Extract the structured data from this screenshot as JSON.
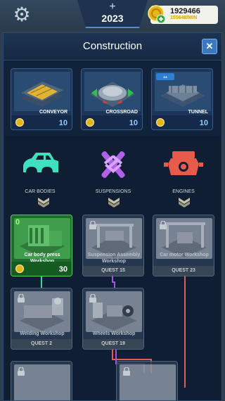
{
  "header": {
    "year_plus": "+",
    "year": "2023",
    "coins": "1929466",
    "rate": "155648/MIN"
  },
  "panel": {
    "title": "Construction",
    "close_label": "✕"
  },
  "top_cards": [
    {
      "name": "CONVEYOR",
      "price": "10"
    },
    {
      "name": "CROSSROAD",
      "price": "10"
    },
    {
      "name": "TUNNEL",
      "price": "10"
    }
  ],
  "categories": [
    {
      "label": "CAR BODIES",
      "color": "#3fe0c0"
    },
    {
      "label": "SUSPENSIONS",
      "color": "#b061e8"
    },
    {
      "label": "ENGINES",
      "color": "#e85a4a"
    }
  ],
  "workshops": [
    {
      "name": "Car body press Workshop",
      "zero": "0",
      "price": "30"
    },
    {
      "name": "Suspension Assembly Workshop",
      "quest": "QUEST 15"
    },
    {
      "name": "Car motor Workshop",
      "quest": "QUEST 23"
    },
    {
      "name": "Welding Workshop",
      "quest": "QUEST 2"
    },
    {
      "name": "Wheels Workshop",
      "quest": "QUEST 19"
    }
  ]
}
